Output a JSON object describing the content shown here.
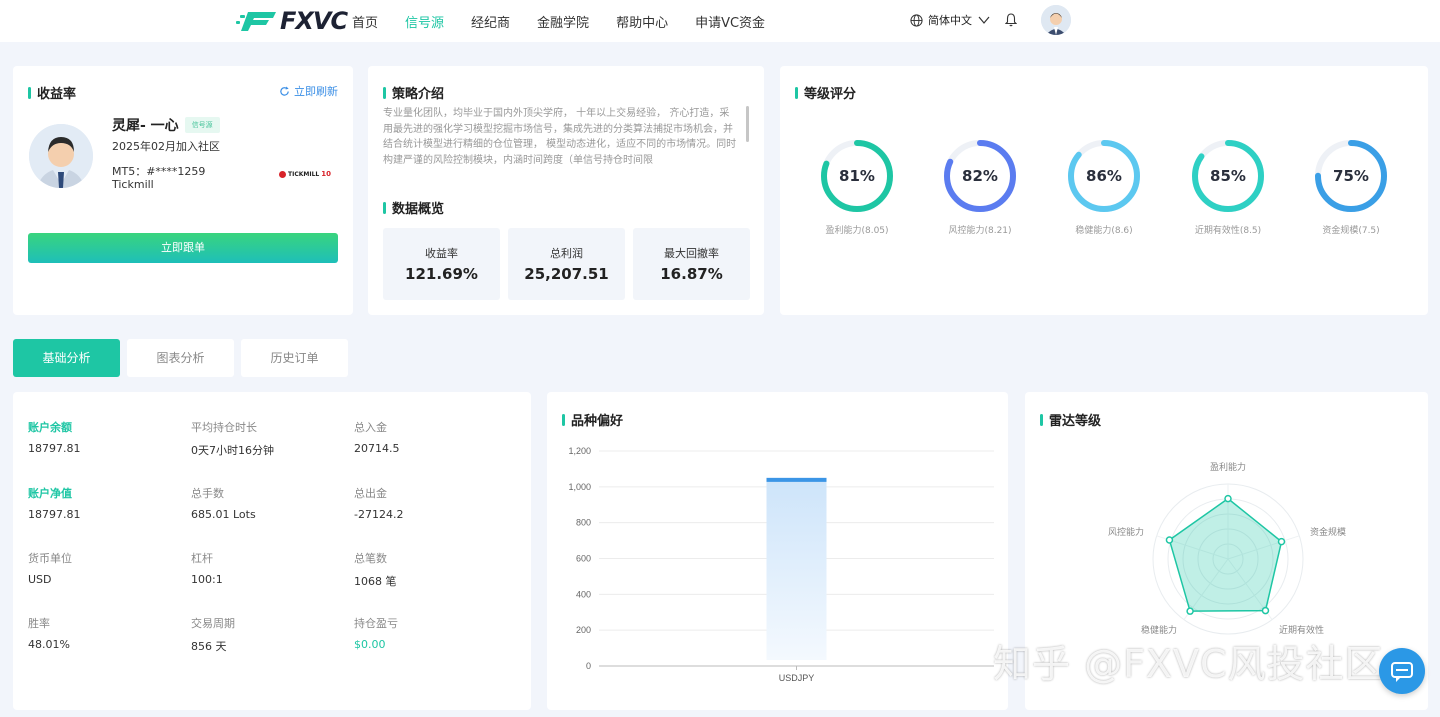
{
  "nav": {
    "logo": "FXVC",
    "links": [
      "首页",
      "信号源",
      "经纪商",
      "金融学院",
      "帮助中心",
      "申请VC资金"
    ],
    "active_index": 1,
    "language": "简体中文",
    "accent": "#1ec6a4"
  },
  "profile": {
    "title": "收益率",
    "refresh": "立即刷新",
    "name": "灵犀- 一心",
    "badge": "信号源",
    "joined": "2025年02月加入社区",
    "mt5": "MT5：#****1259",
    "broker": "Tickmill",
    "broker_logo_text": "TICKMILL",
    "broker_logo_badge": "10",
    "follow_button": "立即跟单"
  },
  "strategy": {
    "title": "策略介绍",
    "text": "专业量化团队，均毕业于国内外顶尖学府， 十年以上交易经验， 齐心打造，采用最先进的强化学习模型挖掘市场信号，集成先进的分类算法捕捉市场机会，并结合统计模型进行精细的仓位管理， 模型动态进化，适应不同的市场情况。同时构建严谨的风险控制模块，内涵时间跨度（单信号持仓时间限",
    "overview_title": "数据概览",
    "stats": [
      {
        "label": "收益率",
        "value": "121.69%"
      },
      {
        "label": "总利润",
        "value": "25,207.51"
      },
      {
        "label": "最大回撤率",
        "value": "16.87%"
      }
    ]
  },
  "rating": {
    "title": "等级评分",
    "items": [
      {
        "value": "81%",
        "percent": 81,
        "label": "盈利能力(8.05)",
        "color": "#1ec6a4"
      },
      {
        "value": "82%",
        "percent": 82,
        "label": "风控能力(8.21)",
        "color": "#5b7cf0"
      },
      {
        "value": "86%",
        "percent": 86,
        "label": "稳健能力(8.6)",
        "color": "#5cc8f0"
      },
      {
        "value": "85%",
        "percent": 85,
        "label": "近期有效性(8.5)",
        "color": "#2ed0c4"
      },
      {
        "value": "75%",
        "percent": 75,
        "label": "资金规模(7.5)",
        "color": "#3a9fe6"
      }
    ]
  },
  "tabs": [
    "基础分析",
    "图表分析",
    "历史订单"
  ],
  "analysis": [
    {
      "label": "账户余额",
      "value": "18797.81",
      "highlight": true
    },
    {
      "label": "平均持仓时长",
      "value": "0天7小时16分钟"
    },
    {
      "label": "总入金",
      "value": "20714.5"
    },
    {
      "label": "账户净值",
      "value": "18797.81",
      "highlight": true
    },
    {
      "label": "总手数",
      "value": "685.01 Lots"
    },
    {
      "label": "总出金",
      "value": "-27124.2"
    },
    {
      "label": "货币单位",
      "value": "USD"
    },
    {
      "label": "杠杆",
      "value": "100:1"
    },
    {
      "label": "总笔数",
      "value": "1068 笔"
    },
    {
      "label": "胜率",
      "value": "48.01%"
    },
    {
      "label": "交易周期",
      "value": "856 天"
    },
    {
      "label": "持仓盈亏",
      "value": "$0.00",
      "value_green": true
    }
  ],
  "preference": {
    "title": "品种偏好"
  },
  "radar": {
    "title": "雷达等级",
    "axes": [
      "盈利能力",
      "资金规模",
      "近期有效性",
      "稳健能力",
      "风控能力"
    ],
    "values": [
      8.05,
      7.5,
      8.5,
      8.6,
      8.21
    ],
    "max": 10
  },
  "chart_data": {
    "type": "bar",
    "categories": [
      "USDJPY"
    ],
    "values": [
      1050
    ],
    "ylim": [
      0,
      1200
    ],
    "yticks": [
      "1,200",
      "1,000",
      "800",
      "600",
      "400",
      "200",
      "0"
    ]
  },
  "watermark": "知乎 @FXVC风投社区"
}
